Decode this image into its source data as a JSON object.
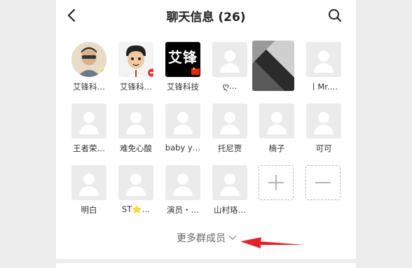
{
  "header": {
    "title": "聊天信息 (26)",
    "back_icon": "chevron-left-icon",
    "search_icon": "search-icon"
  },
  "members": [
    {
      "name": "艾锋科…",
      "avatar": "photo"
    },
    {
      "name": "艾锋科…",
      "avatar": "cartoon"
    },
    {
      "name": "艾锋科技",
      "avatar": "logo-text",
      "avatar_text": "艾锋"
    },
    {
      "name": "ღ…",
      "avatar": "placeholder"
    },
    {
      "name": "…",
      "avatar": "blurred"
    },
    {
      "name": "丨Mr.…",
      "avatar": "placeholder"
    },
    {
      "name": "王者荣…",
      "avatar": "placeholder"
    },
    {
      "name": "难免心酸",
      "avatar": "placeholder"
    },
    {
      "name": "baby y…",
      "avatar": "placeholder"
    },
    {
      "name": "托尼贾",
      "avatar": "placeholder"
    },
    {
      "name": "楠子",
      "avatar": "placeholder"
    },
    {
      "name": "可可",
      "avatar": "placeholder"
    },
    {
      "name": "明白",
      "avatar": "placeholder"
    },
    {
      "name": "ST⭐…",
      "avatar": "placeholder"
    },
    {
      "name": "演员・…",
      "avatar": "placeholder"
    },
    {
      "name": "山村珞…",
      "avatar": "placeholder"
    }
  ],
  "actions": {
    "add_icon": "plus-icon",
    "remove_icon": "minus-icon"
  },
  "more_members": {
    "label": "更多群成员",
    "icon": "chevron-down-icon"
  },
  "annotation": {
    "icon": "red-arrow-icon",
    "color": "#e5222b"
  }
}
